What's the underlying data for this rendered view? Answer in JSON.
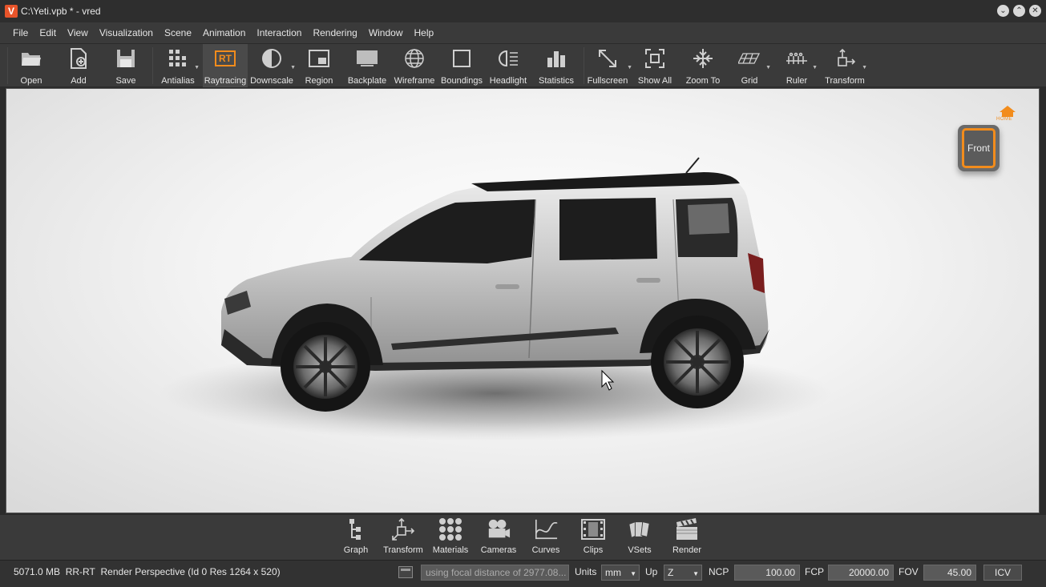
{
  "window": {
    "title": "C:\\Yeti.vpb * - vred",
    "logo": "V"
  },
  "menu": [
    "File",
    "Edit",
    "View",
    "Visualization",
    "Scene",
    "Animation",
    "Interaction",
    "Rendering",
    "Window",
    "Help"
  ],
  "toolbar": {
    "open": "Open",
    "add": "Add",
    "save": "Save",
    "antialias": "Antialias",
    "raytracing": "Raytracing",
    "raytracing_badge": "RT",
    "downscale": "Downscale",
    "region": "Region",
    "backplate": "Backplate",
    "wireframe": "Wireframe",
    "boundings": "Boundings",
    "headlight": "Headlight",
    "statistics": "Statistics",
    "fullscreen": "Fullscreen",
    "show_all": "Show All",
    "zoom_to": "Zoom To",
    "grid": "Grid",
    "ruler": "Ruler",
    "transform": "Transform"
  },
  "viewport": {
    "navcube_face": "Front",
    "home_label": "HOME"
  },
  "dock": [
    "Graph",
    "Transform",
    "Materials",
    "Cameras",
    "Curves",
    "Clips",
    "VSets",
    "Render"
  ],
  "status": {
    "memory": "5071.0 MB",
    "mode": "RR-RT",
    "render_info": "Render Perspective (Id 0 Res 1264 x 520)",
    "message": "using focal distance of 2977.08...",
    "units_label": "Units",
    "units_value": "mm",
    "up_label": "Up",
    "up_value": "Z",
    "ncp_label": "NCP",
    "ncp_value": "100.00",
    "fcp_label": "FCP",
    "fcp_value": "20000.00",
    "fov_label": "FOV",
    "fov_value": "45.00",
    "icv_label": "ICV"
  },
  "colors": {
    "accent": "#f28c1c",
    "logo": "#e8542a",
    "chrome": "#3a3a3a"
  }
}
